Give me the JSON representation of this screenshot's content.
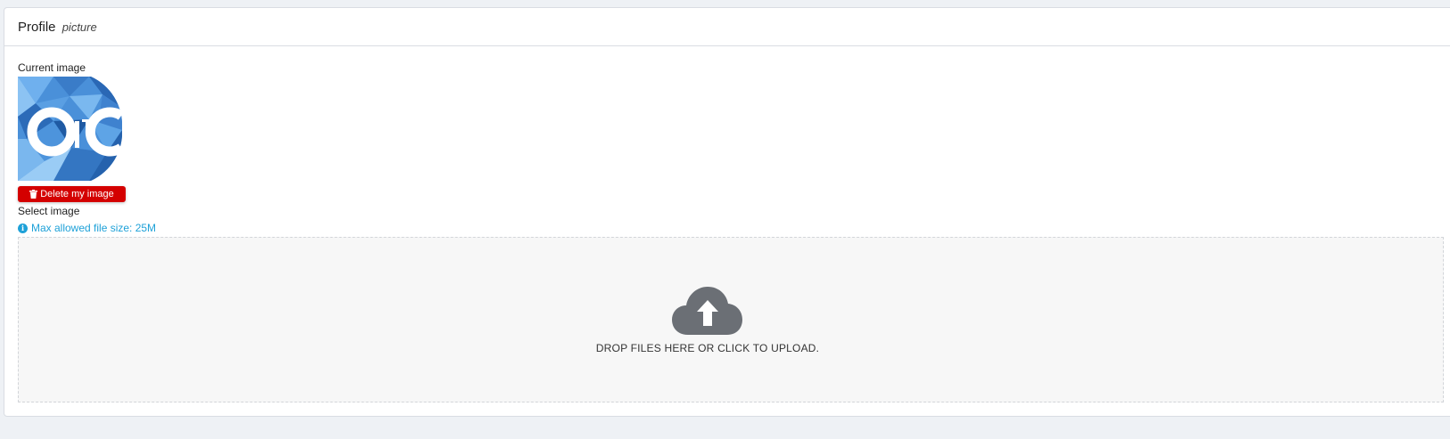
{
  "card": {
    "title": "Profile",
    "subtitle": "picture"
  },
  "current_image": {
    "label": "Current image",
    "logo_text": "OITC"
  },
  "delete_button": {
    "label": "Delete my image",
    "icon": "trash-icon"
  },
  "select_image": {
    "label": "Select image",
    "hint": "Max allowed file size: 25M",
    "hint_icon": "info-icon"
  },
  "dropzone": {
    "text": "DROP FILES HERE OR CLICK TO UPLOAD.",
    "icon": "cloud-upload-icon"
  },
  "colors": {
    "danger": "#d40000",
    "info": "#1ea1d8",
    "dropzone_bg": "#f7f7f7",
    "cloud": "#6b6f75"
  }
}
